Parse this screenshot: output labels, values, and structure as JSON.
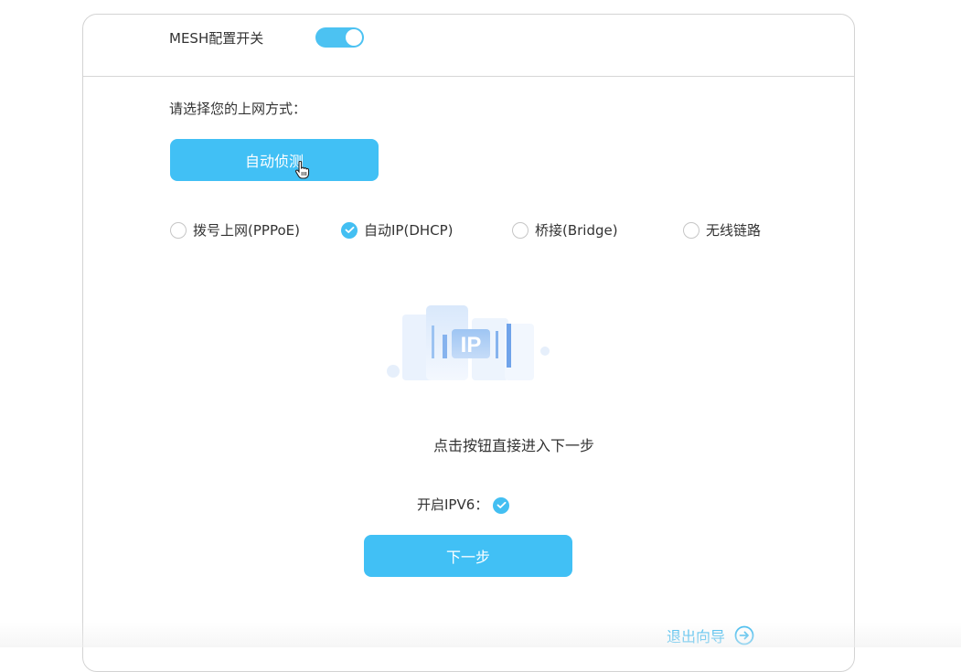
{
  "mesh": {
    "label": "MESH配置开关",
    "enabled": true
  },
  "wizard": {
    "prompt": "请选择您的上网方式：",
    "detect_label": "自动侦测",
    "options": [
      {
        "label": "拨号上网(PPPoE)",
        "checked": false
      },
      {
        "label": "自动IP(DHCP)",
        "checked": true
      },
      {
        "label": "桥接(Bridge)",
        "checked": false
      },
      {
        "label": "无线链路",
        "checked": false
      }
    ],
    "illustration_text": "IP",
    "hint": "点击按钮直接进入下一步",
    "ipv6_label": "开启IPV6：",
    "ipv6_enabled": true,
    "next_label": "下一步",
    "exit_label": "退出向导"
  },
  "colors": {
    "accent": "#41c0f5",
    "exit_link": "#3bb9ef"
  },
  "icons": {
    "cursor": "hand-pointer-icon",
    "radio_check": "check-icon",
    "exit": "arrow-right-circle-icon"
  }
}
